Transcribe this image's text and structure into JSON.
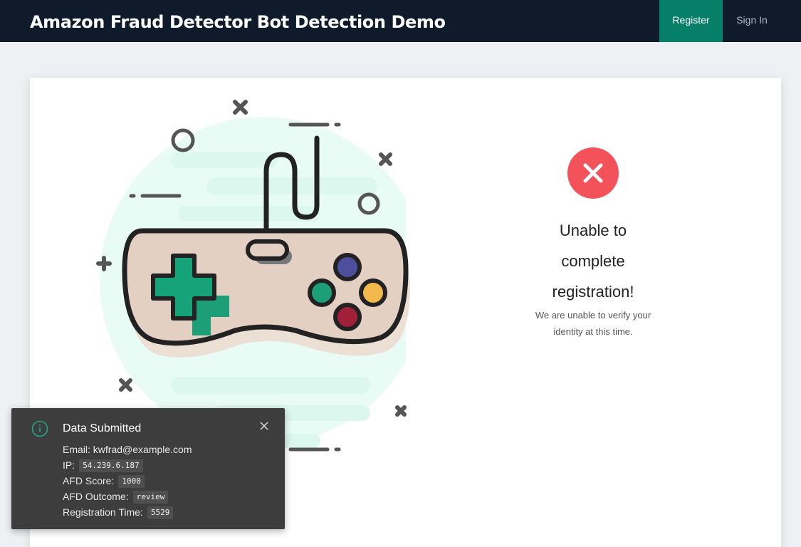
{
  "header": {
    "title": "Amazon Fraud Detector Bot Detection Demo",
    "nav": {
      "register": "Register",
      "sign_in": "Sign In"
    },
    "colors": {
      "background": "#0f1b2b",
      "active": "#067f68"
    }
  },
  "illustration": {
    "icon": "game-controller-illustration"
  },
  "result": {
    "status_icon": "error-x-icon",
    "status_color": "#f3525a",
    "title_lines": [
      "Unable to",
      "complete",
      "registration!"
    ],
    "message_lines": [
      "We are unable to verify your",
      "identity at this time."
    ]
  },
  "toast": {
    "icon": "info-icon",
    "title": "Data Submitted",
    "email_label": "Email:",
    "email_value": "kwfrad@example.com",
    "ip_label": "IP:",
    "ip_value": "54.239.6.187",
    "score_label": "AFD Score:",
    "score_value": "1000",
    "outcome_label": "AFD Outcome:",
    "outcome_value": "review",
    "time_label": "Registration Time:",
    "time_value": "5529"
  }
}
